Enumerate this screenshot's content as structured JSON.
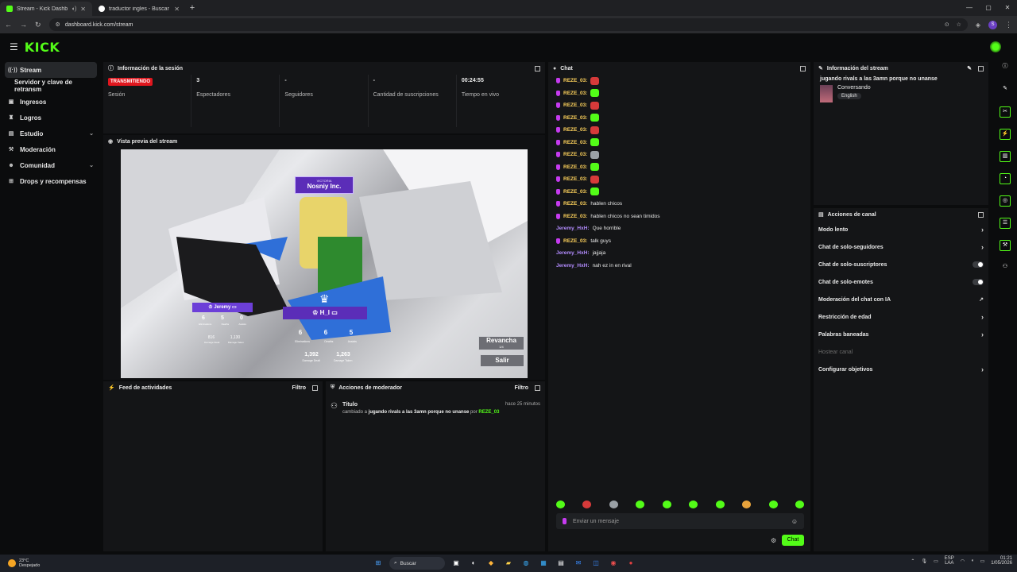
{
  "browser": {
    "tabs": [
      {
        "title": "Stream - Kick Dashboard",
        "active": true
      },
      {
        "title": "traductor ingles - Buscar con G",
        "active": false
      }
    ],
    "url": "dashboard.kick.com/stream",
    "profile_initial": "S"
  },
  "app": {
    "logo": "KICK"
  },
  "sidebar": {
    "items": [
      {
        "label": "Stream",
        "icon": "stream-icon"
      },
      {
        "label": "Servidor y clave de retransm",
        "icon": ""
      },
      {
        "label": "Ingresos",
        "icon": "revenue-icon"
      },
      {
        "label": "Logros",
        "icon": "trophy-icon"
      },
      {
        "label": "Estudio",
        "icon": "studio-icon"
      },
      {
        "label": "Moderación",
        "icon": "hammer-icon"
      },
      {
        "label": "Comunidad",
        "icon": "community-icon"
      },
      {
        "label": "Drops y recompensas",
        "icon": "gift-icon"
      }
    ]
  },
  "session": {
    "title": "Información de la sesión",
    "live_badge": "TRANSMITIENDO",
    "stats": [
      {
        "value": "",
        "label": "Sesión"
      },
      {
        "value": "3",
        "label": "Espectadores"
      },
      {
        "value": "-",
        "label": "Seguidores"
      },
      {
        "value": "-",
        "label": "Cantidad de suscripciones"
      },
      {
        "value": "00:24:55",
        "label": "Tiempo en vivo"
      }
    ]
  },
  "preview": {
    "title": "Vista previa del stream",
    "victory_label": "VICTORIA",
    "team_name": "Nosniy Inc.",
    "player_left": "Jeremy",
    "player_right": "H_I",
    "left_stats": [
      "6",
      "5",
      "0"
    ],
    "left_stats2": [
      "816",
      "1,130"
    ],
    "right_stats": [
      "6",
      "6",
      "5"
    ],
    "right_stats2": [
      "1,392",
      "1,263"
    ],
    "stat_labels": [
      "Eliminations",
      "Deaths",
      "Assists"
    ],
    "stat_labels2": [
      "Damage Dealt",
      "Damage Taken"
    ],
    "rematch_label": "Revancha",
    "rematch_count": "1/4",
    "exit_label": "Salir"
  },
  "activity": {
    "title": "Feed de actividades",
    "filter": "Filtro"
  },
  "modactions": {
    "title": "Acciones de moderador",
    "filter": "Filtro",
    "entry_title": "Título",
    "entry_time": "hace 25 minutos",
    "entry_prefix": "cambiado a",
    "entry_value": "jugando rivals a las 3amn porque no unanse",
    "entry_by": "por",
    "entry_user": "REZE_03"
  },
  "chat": {
    "title": "Chat",
    "messages": [
      {
        "user": "REZE_03:",
        "msg": "",
        "emote": "#d63a3a",
        "badge": true
      },
      {
        "user": "REZE_03:",
        "msg": "",
        "emote": "#53fc18",
        "badge": true
      },
      {
        "user": "REZE_03:",
        "msg": "",
        "emote": "#d63a3a",
        "badge": true
      },
      {
        "user": "REZE_03:",
        "msg": "",
        "emote": "#53fc18",
        "badge": true
      },
      {
        "user": "REZE_03:",
        "msg": "",
        "emote": "#d63a3a",
        "badge": true
      },
      {
        "user": "REZE_03:",
        "msg": "",
        "emote": "#53fc18",
        "badge": true
      },
      {
        "user": "REZE_03:",
        "msg": "",
        "emote": "#9aa0a6",
        "badge": true
      },
      {
        "user": "REZE_03:",
        "msg": "",
        "emote": "#53fc18",
        "badge": true
      },
      {
        "user": "REZE_03:",
        "msg": "",
        "emote": "#d63a3a",
        "badge": true
      },
      {
        "user": "REZE_03:",
        "msg": "",
        "emote": "#53fc18",
        "badge": true
      },
      {
        "user": "REZE_03:",
        "msg": "hablen chicos",
        "emote": "",
        "badge": true
      },
      {
        "user": "REZE_03:",
        "msg": "hablen chicos no sean timidos",
        "emote": "",
        "badge": true
      },
      {
        "user": "Jeremy_HxH:",
        "msg": "Que horrible",
        "emote": "",
        "badge": false
      },
      {
        "user": "REZE_03:",
        "msg": "talk guys",
        "emote": "",
        "badge": true
      },
      {
        "user": "Jeremy_HxH:",
        "msg": "jajjaja",
        "emote": "",
        "badge": false
      },
      {
        "user": "Jeremy_HxH:",
        "msg": "nah ez in en rival",
        "emote": "",
        "badge": false
      }
    ],
    "emote_bar": [
      "#53fc18",
      "#d63a3a",
      "#9aa0a6",
      "#53fc18",
      "#53fc18",
      "#53fc18",
      "#53fc18",
      "#e8a33c",
      "#53fc18",
      "#53fc18"
    ],
    "input_placeholder": "Enviar un mensaje",
    "send_label": "Chat"
  },
  "streaminfo": {
    "title": "Información del stream",
    "stream_title": "jugando rivals a las 3amn porque no unanse",
    "category": "Conversando",
    "language": "English"
  },
  "channel_actions": {
    "title": "Acciones de canal",
    "rows": [
      {
        "label": "Modo lento",
        "kind": "chevron"
      },
      {
        "label": "Chat de solo-seguidores",
        "kind": "chevron"
      },
      {
        "label": "Chat de solo-suscriptores",
        "kind": "toggle"
      },
      {
        "label": "Chat de solo-emotes",
        "kind": "toggle"
      },
      {
        "label": "Moderación del chat con IA",
        "kind": "external"
      },
      {
        "label": "Restricción de edad",
        "kind": "chevron"
      },
      {
        "label": "Palabras baneadas",
        "kind": "chevron"
      },
      {
        "label": "Hostear canal",
        "kind": "disabled"
      },
      {
        "label": "Configurar objetivos",
        "kind": "chevron"
      }
    ]
  },
  "taskbar": {
    "temp": "23°C",
    "weather": "Despejado",
    "search_placeholder": "Buscar",
    "lang": "ESP",
    "lang2": "LAA",
    "time": "01:21",
    "date": "1/05/2026"
  }
}
